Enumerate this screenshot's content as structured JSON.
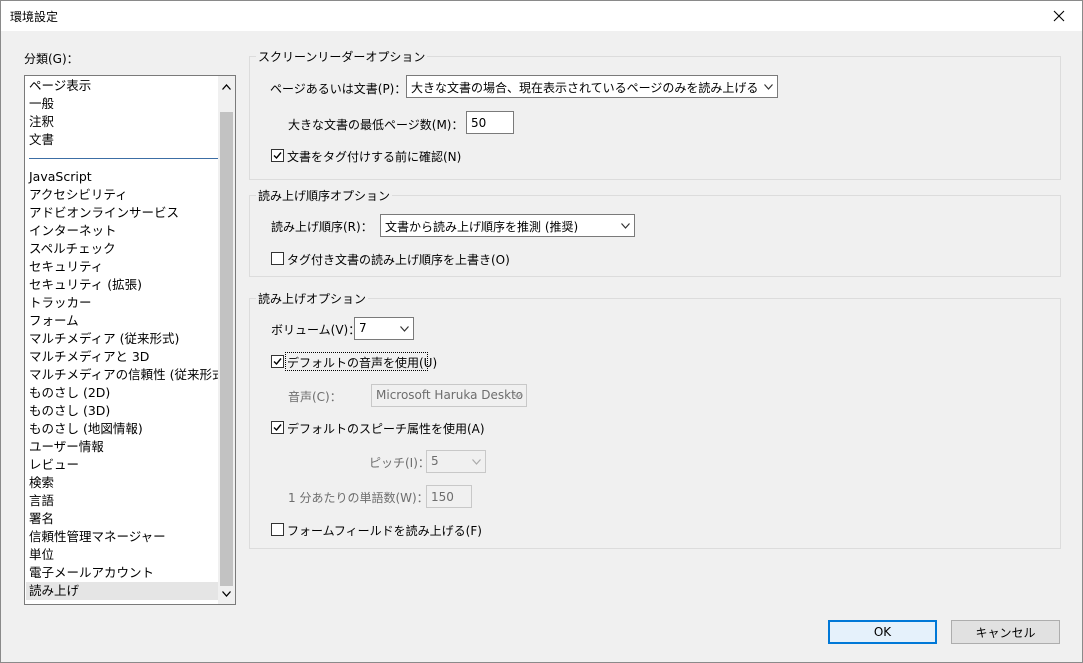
{
  "window": {
    "title": "環境設定"
  },
  "category": {
    "label": "分類(G)：",
    "items": [
      "ページ表示",
      "一般",
      "注釈",
      "文書",
      "JavaScript",
      "アクセシビリティ",
      "アドビオンラインサービス",
      "インターネット",
      "スペルチェック",
      "セキュリティ",
      "セキュリティ (拡張)",
      "トラッカー",
      "フォーム",
      "マルチメディア (従来形式)",
      "マルチメディアと 3D",
      "マルチメディアの信頼性 (従来形式)",
      "ものさし (2D)",
      "ものさし (3D)",
      "ものさし (地図情報)",
      "ユーザー情報",
      "レビュー",
      "検索",
      "言語",
      "署名",
      "信頼性管理マネージャー",
      "単位",
      "電子メールアカウント",
      "読み上げ"
    ],
    "selected": "読み上げ"
  },
  "screen_reader": {
    "title": "スクリーンリーダーオプション",
    "page_or_doc_label": "ページあるいは文書(P)：",
    "page_or_doc_value": "大きな文書の場合、現在表示されているページのみを読み上げる",
    "min_pages_label": "大きな文書の最低ページ数(M)：",
    "min_pages_value": "50",
    "confirm_tag_label": "文書をタグ付けする前に確認(N)",
    "confirm_tag_checked": true
  },
  "reading_order": {
    "title": "読み上げ順序オプション",
    "order_label": "読み上げ順序(R)：",
    "order_value": "文書から読み上げ順序を推測 (推奨)",
    "override_label": "タグ付き文書の読み上げ順序を上書き(O)",
    "override_checked": false
  },
  "read_out": {
    "title": "読み上げオプション",
    "volume_label": "ボリューム(V)：",
    "volume_value": "7",
    "default_voice_label": "デフォルトの音声を使用(U)",
    "default_voice_checked": true,
    "voice_label": "音声(C)：",
    "voice_value": "Microsoft Haruka Deskto",
    "default_speech_label": "デフォルトのスピーチ属性を使用(A)",
    "default_speech_checked": true,
    "pitch_label": "ピッチ(I)：",
    "pitch_value": "5",
    "words_label": "1 分あたりの単語数(W)：",
    "words_value": "150",
    "form_fields_label": "フォームフィールドを読み上げる(F)",
    "form_fields_checked": false
  },
  "buttons": {
    "ok": "OK",
    "cancel": "キャンセル"
  }
}
